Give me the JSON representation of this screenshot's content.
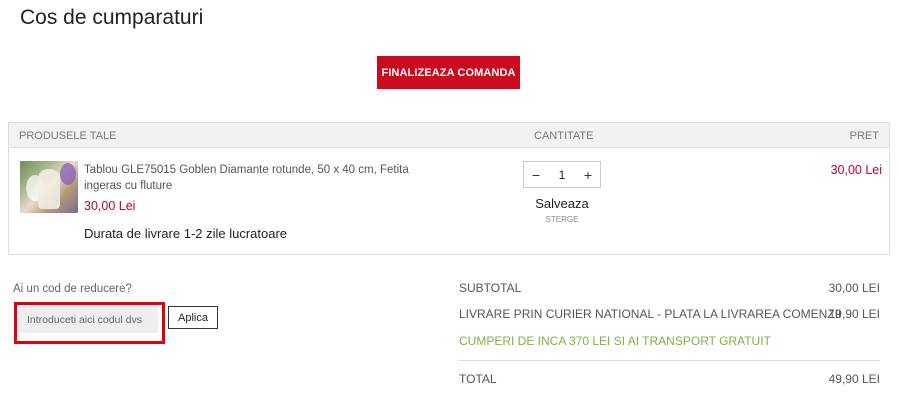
{
  "page": {
    "title": "Cos de cumparaturi"
  },
  "checkout": {
    "label": "FINALIZEAZA COMANDA"
  },
  "cart": {
    "columns": {
      "products": "PRODUSELE TALE",
      "quantity": "CANTITATE",
      "price": "PRET"
    },
    "item": {
      "name": "Tablou GLE75015 Goblen Diamante rotunde, 50 x 40 cm, Fetita ingeras cu fluture",
      "unit_price": "30,00 Lei",
      "delivery": "Durata de livrare 1-2 zile lucratoare",
      "quantity": "1",
      "minus": "−",
      "plus": "+",
      "save": "Salveaza",
      "delete": "STERGE",
      "price": "30,00 Lei"
    }
  },
  "discount": {
    "label": "Ai un cod de reducere?",
    "placeholder": "Introduceti aici codul dvs",
    "value": "",
    "apply": "Aplica"
  },
  "summary": {
    "subtotal": {
      "label": "SUBTOTAL",
      "value": "30,00 LEI"
    },
    "shipping": {
      "label": "LIVRARE PRIN CURIER NATIONAL - PLATA LA LIVRAREA COMENZII",
      "value": "19,90 LEI"
    },
    "free_shipping_note": "CUMPERI DE INCA 370 LEI SI AI TRANSPORT GRATUIT",
    "total": {
      "label": "TOTAL",
      "value": "49,90 LEI"
    }
  },
  "colors": {
    "accent": "#cc0a1e",
    "price": "#c2002f",
    "promo": "#7cb342",
    "highlight": "#e00010"
  }
}
